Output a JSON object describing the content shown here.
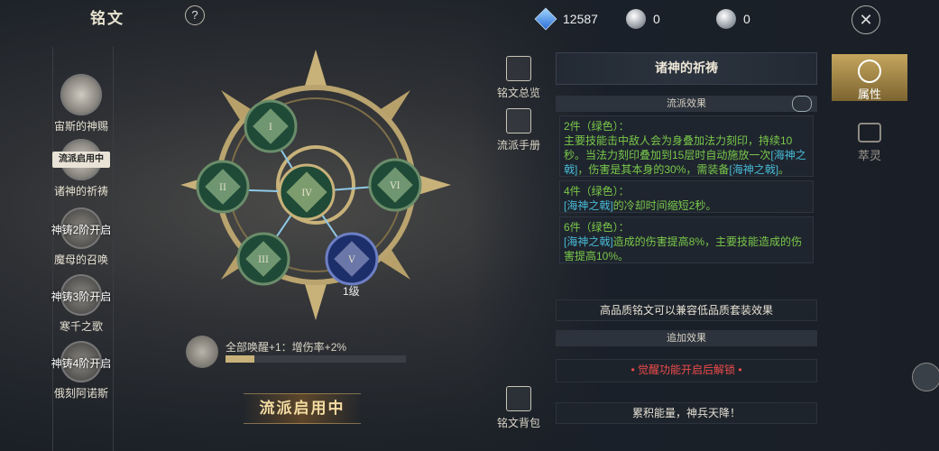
{
  "header": {
    "title": "铭文",
    "help_label": "?",
    "currencies": [
      {
        "icon": "diamond-icon",
        "value": "12587"
      },
      {
        "icon": "silver-coin-icon",
        "value": "0"
      },
      {
        "icon": "silver-coin-icon",
        "value": "0"
      }
    ]
  },
  "sidebar": {
    "items": [
      {
        "label": "宙斯的神赐",
        "lock": ""
      },
      {
        "label": "诸神的祈祷",
        "tag": "流派启用中",
        "lock": ""
      },
      {
        "label": "魔母的召唤",
        "lock": "神铸2阶开启"
      },
      {
        "label": "寒千之歌",
        "lock": "神铸3阶开启"
      },
      {
        "label": "俄刻阿诺斯",
        "lock": "神铸4阶开启"
      }
    ]
  },
  "emblem": {
    "nodes": [
      "I",
      "II",
      "IV",
      "VI",
      "III",
      "V"
    ],
    "level": "1级"
  },
  "bonus": {
    "text": "全部唤醒+1：增伤率+2%",
    "progress": 0.16
  },
  "active_button": "流派启用中",
  "tools": {
    "overview": "铭文总览",
    "manual": "流派手册",
    "bag": "铭文背包"
  },
  "panel": {
    "title": "诸神的祈祷",
    "school_effect": "流派效果",
    "set2_head": "2件（绿色）：",
    "set2_a": "主要技能击中敌人会为身叠加法力刻印，持续10秒。当法力刻印叠加到15层时自动施放一次",
    "set2_link": "[海神之戟]",
    "set2_b": "，伤害是其本身的30%，需装备",
    "set2_link2": "[海神之戟]",
    "set2_c": "。",
    "set4_head": "4件（绿色）：",
    "set4_link": "[海神之戟]",
    "set4_text": "的冷却时间缩短2秒。",
    "set6_head": "6件（绿色）：",
    "set6_link": "[海神之戟]",
    "set6_text": "造成的伤害提高8%，主要技能造成的伤害提高10%。",
    "compat_note": "高品质铭文可以兼容低品质套装效果",
    "extra_head": "追加效果",
    "extra_locked": "• 觉醒功能开启后解锁 •",
    "footer_note": "累积能量，神兵天降！"
  },
  "right_tabs": {
    "attribute": "属性",
    "soul": "萃灵"
  },
  "colors": {
    "accent_gold": "#c5a65e",
    "set_green": "#79c84a",
    "link_teal": "#47b9d6",
    "lock_red": "#ee4b4b"
  }
}
